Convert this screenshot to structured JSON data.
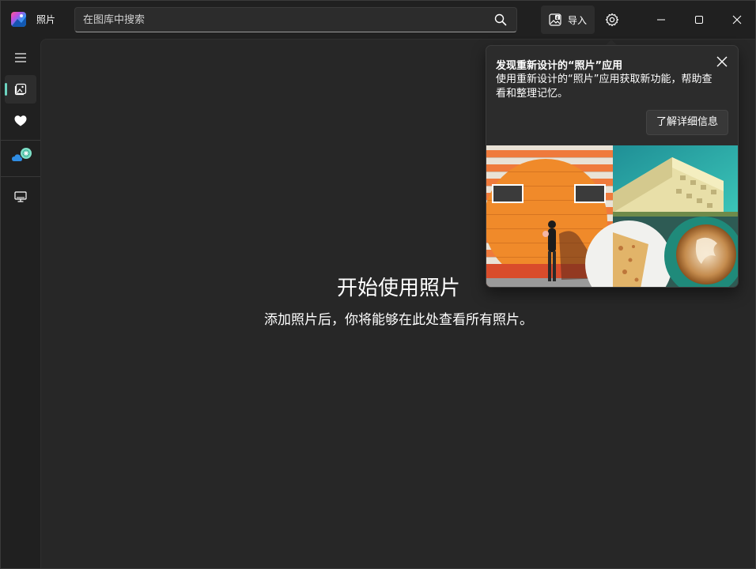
{
  "app": {
    "title": "照片"
  },
  "search": {
    "placeholder": "在图库中搜索"
  },
  "toolbar": {
    "import_label": "导入"
  },
  "empty_state": {
    "title": "开始使用照片",
    "subtitle": "添加照片后，你将能够在此处查看所有照片。"
  },
  "popup": {
    "title": "发现重新设计的“照片”应用",
    "body": "使用重新设计的“照片”应用获取新功能，帮助查看和整理记忆。",
    "learn_more_label": "了解详细信息"
  },
  "colors": {
    "background": "#202020",
    "content": "#272727",
    "accent": "#6cd3c0",
    "popup": "#2c2c2c"
  },
  "icons": {
    "app": "photos-app-icon",
    "search": "search-icon",
    "import": "import-icon",
    "settings": "gear-icon",
    "menu": "hamburger-icon",
    "gallery": "gallery-icon",
    "favorites": "heart-icon",
    "onedrive": "cloud-icon",
    "device": "monitor-icon"
  }
}
